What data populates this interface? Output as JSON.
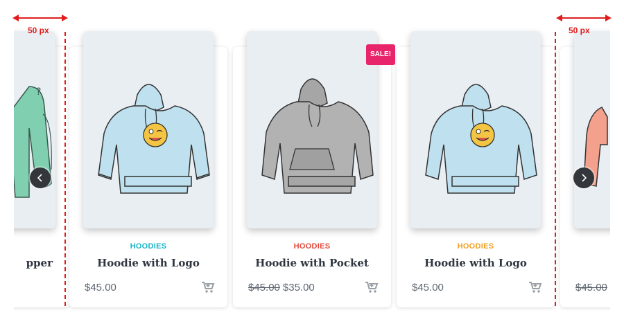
{
  "annotations": {
    "left_gap_label": "50 px",
    "right_gap_label": "50 px",
    "color": "#e01d1d"
  },
  "carousel": {
    "prev_icon": "chevron-left-icon",
    "next_icon": "chevron-right-icon",
    "products": [
      {
        "category": "",
        "category_color": "#17a2b8",
        "title": "pper",
        "price": "",
        "old_price": "",
        "image_icon": "hoodie-green-icon"
      },
      {
        "category": "HOODIES",
        "category_color": "#17b3c8",
        "title": "Hoodie with Logo",
        "price": "$45.00",
        "old_price": "",
        "image_icon": "hoodie-with-logo-icon"
      },
      {
        "category": "HOODIES",
        "category_color": "#e0483b",
        "title": "Hoodie with Pocket",
        "price": "$35.00",
        "old_price": "$45.00",
        "sale_badge": "SALE!",
        "image_icon": "hoodie-with-pocket-icon"
      },
      {
        "category": "HOODIES",
        "category_color": "#f0a020",
        "title": "Hoodie with Logo",
        "price": "$45.00",
        "old_price": "",
        "image_icon": "hoodie-with-logo-icon"
      },
      {
        "category": "",
        "category_color": "#17a2b8",
        "title": "",
        "price": "$",
        "old_price": "$45.00",
        "image_icon": "hoodie-red-icon"
      }
    ]
  },
  "colors": {
    "card_image_bg": "#e9eef3",
    "cart_icon": "#9aa0a6",
    "sale_badge": "#e8256a",
    "nav_button": "#33363a"
  }
}
